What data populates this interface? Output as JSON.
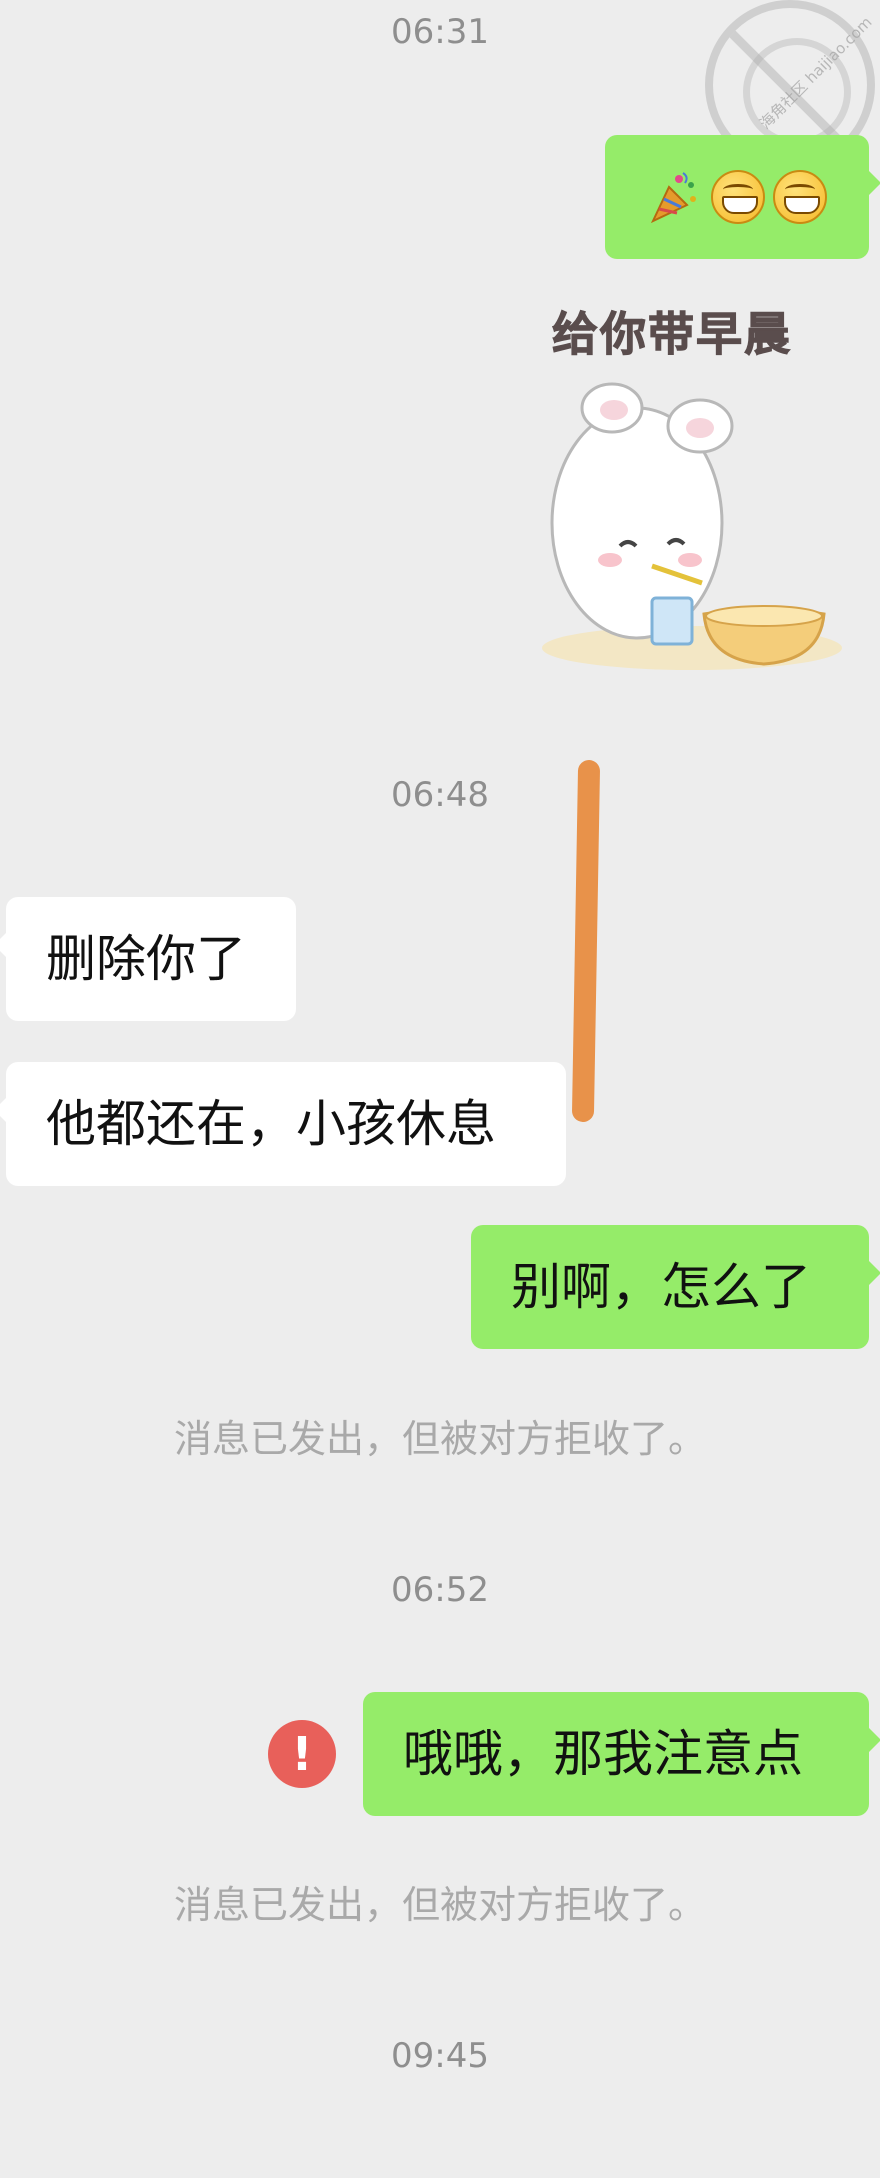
{
  "timestamps": [
    "06:31",
    "06:48",
    "06:52",
    "09:45"
  ],
  "sticker": {
    "caption": "给你带早晨"
  },
  "watermark": {
    "text": "海角社区 haijiao.com"
  },
  "messages": {
    "out_emoji": {
      "icons": [
        "party-popper-icon",
        "grinning-face-icon",
        "grinning-face-icon"
      ]
    },
    "in_1": "删除你了",
    "in_2": "他都还在，小孩休息",
    "out_1": "别啊，怎么了",
    "out_2": "哦哦，那我注意点"
  },
  "system_notes": {
    "rejected_1": "消息已发出，但被对方拒收了。",
    "rejected_2": "消息已发出，但被对方拒收了。"
  },
  "status": {
    "error_badge": "!"
  },
  "colors": {
    "background": "#ededed",
    "outgoing_bubble": "#95ec69",
    "incoming_bubble": "#ffffff",
    "error": "#e8605a",
    "annotation_stroke": "#e8924a"
  }
}
